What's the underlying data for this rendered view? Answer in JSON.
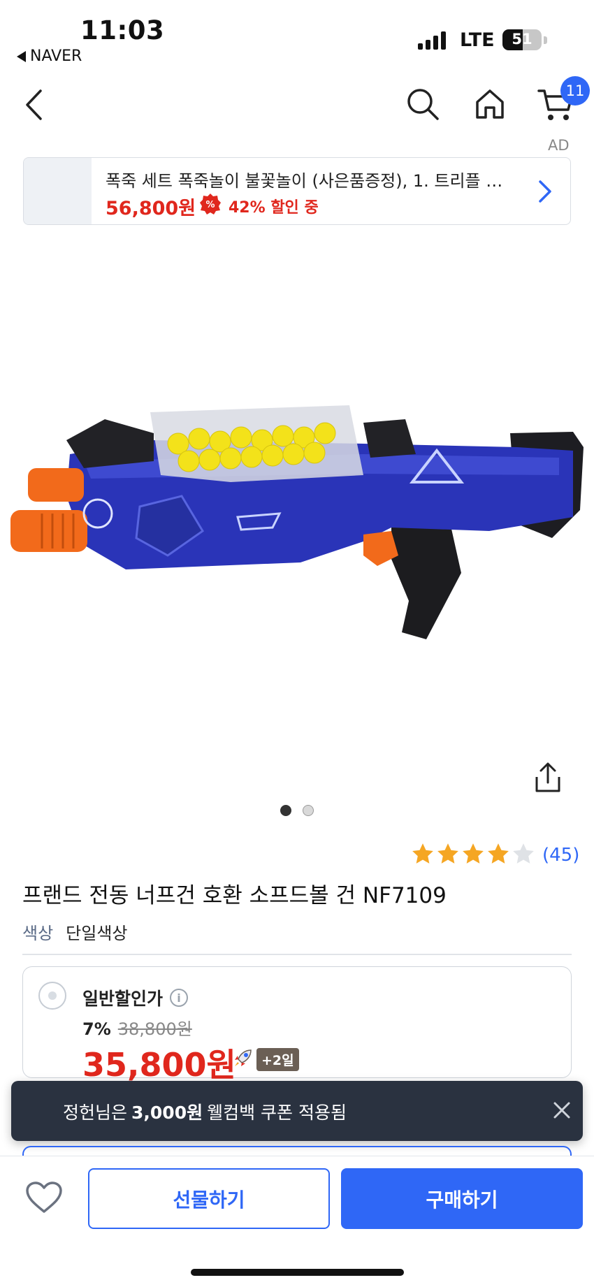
{
  "status_bar": {
    "time": "11:03",
    "back_app": "NAVER",
    "network": "LTE",
    "battery": "51",
    "battery_level": 0.51
  },
  "nav": {
    "cart_count": "11",
    "icons": [
      "back-chevron-icon",
      "search-icon",
      "home-icon",
      "cart-icon"
    ]
  },
  "ad": {
    "label": "AD",
    "title": "폭죽 세트 폭죽놀이 불꽃놀이 (사은품증정), 1. 트리플 …",
    "price": "56,800원",
    "badge_symbol": "%",
    "discount": "42% 할인 중"
  },
  "gallery": {
    "page_count": 2,
    "active_index": 0
  },
  "product": {
    "rating_stars": 4,
    "review_count": "(45)",
    "title": "프랜드 전동 너프건 호환 소프드볼 건 NF7109",
    "option_label": "색상",
    "option_value": "단일색상"
  },
  "price_card": {
    "plan_label": "일반할인가",
    "discount_rate": "7%",
    "original_price": "38,800원",
    "final_price": "35,800원",
    "delivery_badge": "+2일"
  },
  "toast": {
    "prefix": "정헌님은",
    "amount": "3,000원",
    "suffix": "웰컴백 쿠폰 적용됨"
  },
  "bottom_bar": {
    "gift_label": "선물하기",
    "buy_label": "구매하기"
  },
  "colors": {
    "accent": "#2f67f6",
    "price_red": "#e0271d",
    "star": "#f5a623",
    "toast_bg": "#2a3240"
  }
}
